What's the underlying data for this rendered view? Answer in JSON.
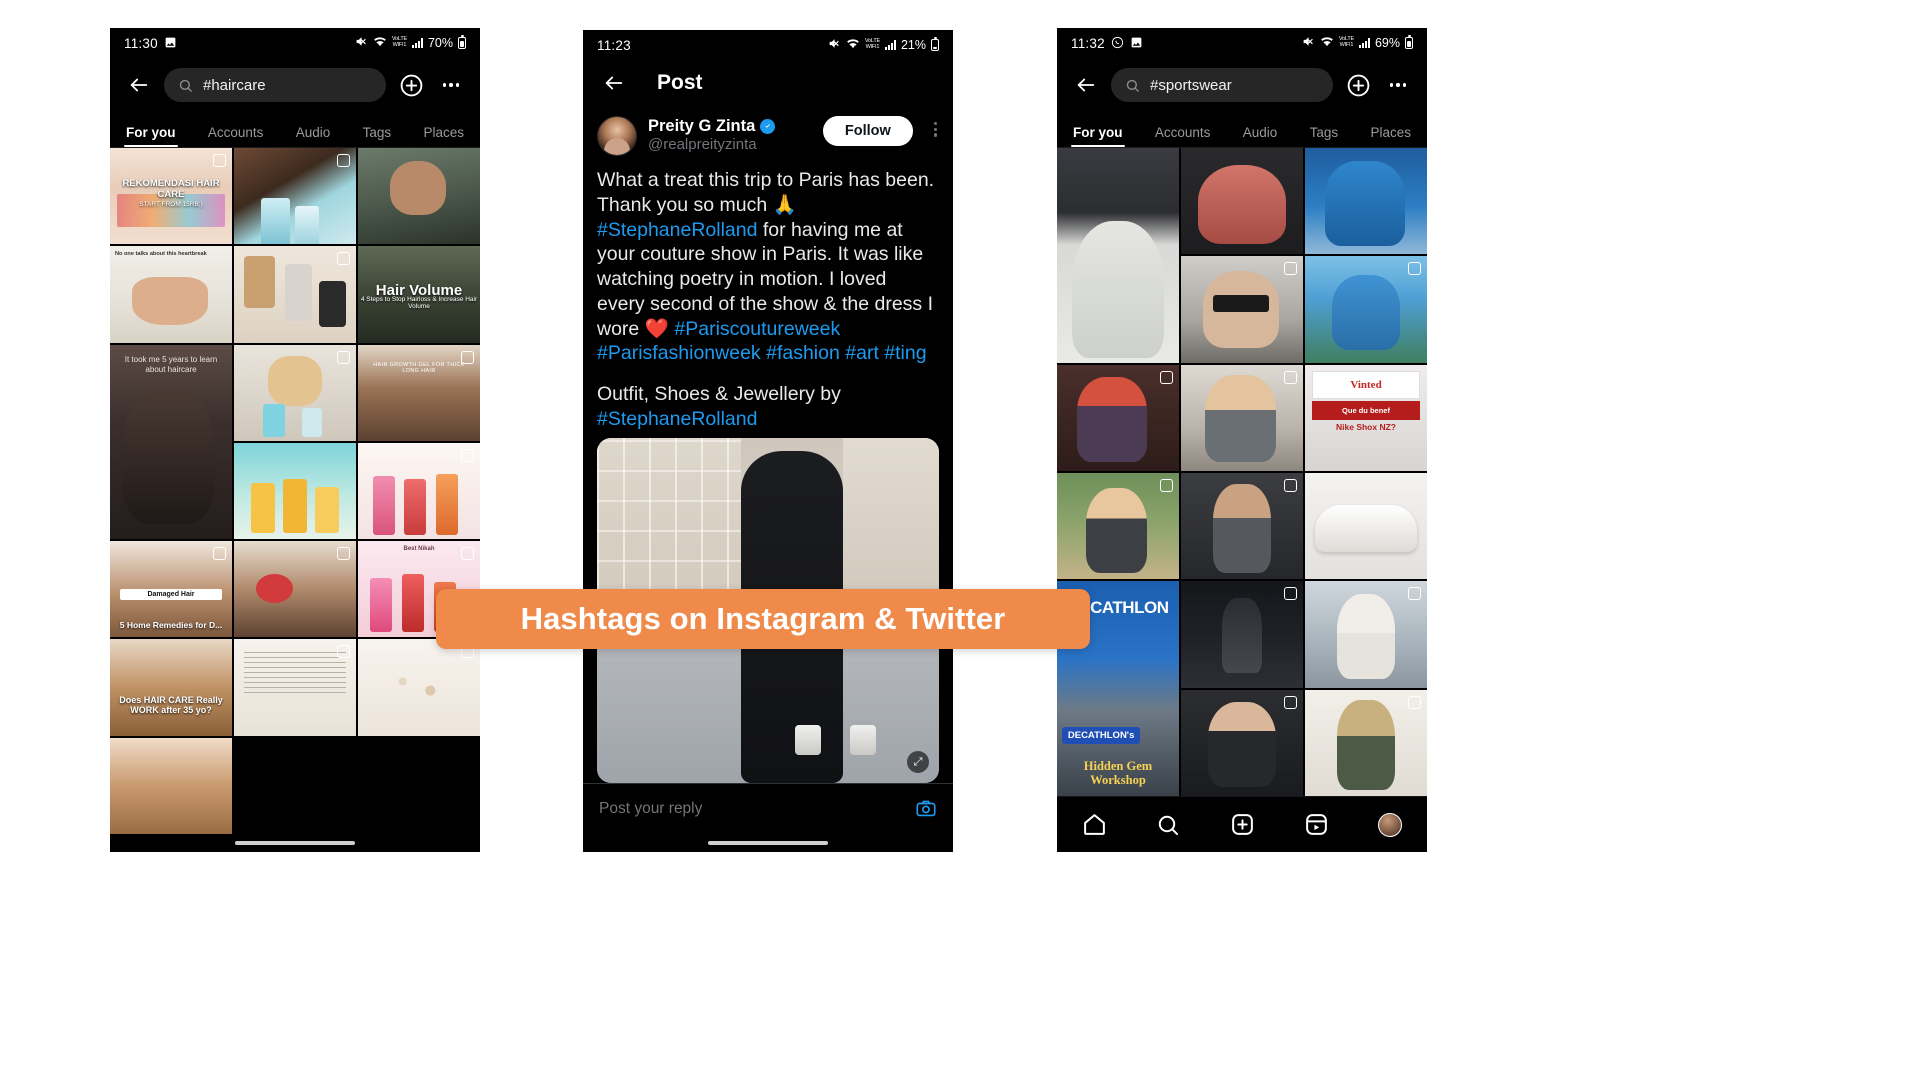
{
  "banner": {
    "text": "Hashtags on Instagram & Twitter",
    "color": "#f08a4b"
  },
  "phone1": {
    "status": {
      "time": "11:30",
      "battery_text": "70%",
      "volte": "VoLTE",
      "wifi_label": "WIFI1"
    },
    "search": {
      "query": "#haircare",
      "placeholder": "Search"
    },
    "tabs": [
      {
        "label": "For you",
        "active": true
      },
      {
        "label": "Accounts",
        "active": false
      },
      {
        "label": "Audio",
        "active": false
      },
      {
        "label": "Tags",
        "active": false
      },
      {
        "label": "Places",
        "active": false
      }
    ],
    "grid": [
      {
        "caption": "REKOMENDASI HAIR CARE",
        "caption2": "START FROM 15RB;)",
        "multi": true
      },
      {
        "caption": "",
        "multi": true
      },
      {
        "caption": "",
        "multi": false
      },
      {
        "caption": "No one talks about this heartbreak",
        "multi": false
      },
      {
        "caption": "",
        "multi": true
      },
      {
        "caption": "Hair Volume",
        "caption2": "4 Steps to Stop Hairloss & Increase Hair Volume",
        "multi": false
      },
      {
        "caption": "It took me 5 years to learn about haircare",
        "multi": false
      },
      {
        "caption": "",
        "multi": true
      },
      {
        "caption": "HAIR GROWTH GEL FOR THICK LONG HAIR",
        "multi": true
      },
      {
        "caption": "",
        "multi": false
      },
      {
        "caption": "",
        "multi": true
      },
      {
        "caption": "Damaged Hair",
        "caption2": "5 Home Remedies for D...",
        "multi": true
      },
      {
        "caption": "",
        "multi": true
      },
      {
        "caption": "Best Nikah",
        "multi": true
      },
      {
        "caption": "Does HAIR CARE Really WORK after 35 yo?",
        "multi": false
      },
      {
        "caption": "",
        "multi": true
      },
      {
        "caption": "",
        "multi": true
      },
      {
        "caption": "",
        "multi": false
      }
    ]
  },
  "phone2": {
    "status": {
      "time": "11:23",
      "battery_text": "21%",
      "volte": "VoLTE",
      "wifi_label": "WIFI1"
    },
    "header": {
      "title": "Post"
    },
    "post": {
      "name": "Preity G Zinta",
      "handle": "@realpreityzinta",
      "verified": true,
      "follow_label": "Follow",
      "paragraph1_parts": [
        {
          "text": "What a treat this trip to Paris has been. Thank you so much 🙏 ",
          "link": false
        },
        {
          "text": "#StephaneRolland",
          "link": true
        },
        {
          "text": " for having me at your couture show in Paris. It was like watching poetry in motion. I loved every second of the show & the dress I wore ❤️ ",
          "link": false
        },
        {
          "text": "#Pariscoutureweek",
          "link": true
        },
        {
          "text": " ",
          "link": false
        },
        {
          "text": "#Parisfashionweek",
          "link": true
        },
        {
          "text": " ",
          "link": false
        },
        {
          "text": "#fashion",
          "link": true
        },
        {
          "text": " ",
          "link": false
        },
        {
          "text": "#art",
          "link": true
        },
        {
          "text": " ",
          "link": false
        },
        {
          "text": "#ting",
          "link": true
        }
      ],
      "paragraph2_parts": [
        {
          "text": "Outfit, Shoes & Jewellery by ",
          "link": false
        },
        {
          "text": "#StephaneRolland",
          "link": true
        }
      ]
    },
    "reply": {
      "placeholder": "Post your reply",
      "camera_icon": "camera-icon"
    }
  },
  "phone3": {
    "status": {
      "time": "11:32",
      "battery_text": "69%",
      "volte": "VoLTE",
      "wifi_label": "WIFI1"
    },
    "search": {
      "query": "#sportswear",
      "placeholder": "Search"
    },
    "tabs": [
      {
        "label": "For you",
        "active": true
      },
      {
        "label": "Accounts",
        "active": false
      },
      {
        "label": "Audio",
        "active": false
      },
      {
        "label": "Tags",
        "active": false
      },
      {
        "label": "Places",
        "active": false
      }
    ],
    "grid": [
      {
        "caption": "",
        "multi": false
      },
      {
        "caption": "",
        "multi": false
      },
      {
        "caption": "",
        "multi": false
      },
      {
        "caption": "",
        "multi": false
      },
      {
        "caption": "",
        "multi": true
      },
      {
        "caption": "",
        "multi": true
      },
      {
        "caption": "",
        "multi": true
      },
      {
        "caption": "",
        "multi": true
      },
      {
        "caption": "Vinted",
        "caption2": "Que du benef",
        "caption3": "Nike Shox NZ?",
        "multi": false
      },
      {
        "caption": "",
        "multi": true
      },
      {
        "caption": "",
        "multi": true
      },
      {
        "caption": "",
        "multi": false
      },
      {
        "caption": "DECATHLON",
        "multi": false
      },
      {
        "caption": "",
        "multi": true
      },
      {
        "caption": "",
        "multi": true
      },
      {
        "caption": "DECATHLON's",
        "caption2": "Hidden Gem Workshop",
        "multi": false
      },
      {
        "caption": "",
        "multi": true
      },
      {
        "caption": "",
        "multi": true
      }
    ],
    "nav": [
      {
        "icon": "home-icon",
        "label": "Home"
      },
      {
        "icon": "search-icon",
        "label": "Search"
      },
      {
        "icon": "plus-square-icon",
        "label": "Create"
      },
      {
        "icon": "reels-icon",
        "label": "Reels"
      },
      {
        "icon": "profile-avatar",
        "label": "Profile"
      }
    ]
  }
}
